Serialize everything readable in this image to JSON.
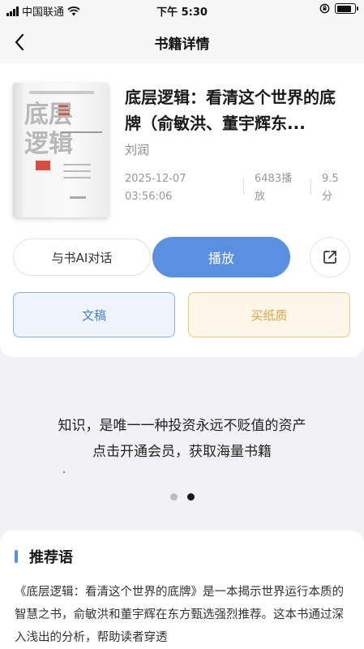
{
  "status_bar": {
    "carrier": "中国联通",
    "time": "下午 5:30",
    "battery_level": 0.85,
    "icons": [
      "signal-icon",
      "wifi-icon",
      "orientation-lock-icon",
      "battery-icon"
    ]
  },
  "nav": {
    "title": "书籍详情",
    "back_icon": "chevron-left-icon"
  },
  "book": {
    "title": "底层逻辑：看清这个世界的底牌（俞敏洪、董宇辉东...",
    "author": "刘润",
    "date": "2025-12-07",
    "time": "03:56:06",
    "plays": "6483播放",
    "score": "9.5分",
    "cover_title": "底层逻辑"
  },
  "actions": {
    "ai_chat_label": "与书AI对话",
    "play_label": "播放",
    "share_icon": "share-icon",
    "doc_label": "文稿",
    "paper_label": "买纸质"
  },
  "promo": {
    "line1": "知识，是唯一一种投资永远不贬值的资产",
    "line2": "点击开通会员，获取海量书籍",
    "page_count": 2,
    "active_page": 2
  },
  "recommend": {
    "heading": "推荐语",
    "text": "《底层逻辑：看清这个世界的底牌》是一本揭示世界运行本质的智慧之书，俞敏洪和董宇辉在东方甄选强烈推荐。这本书通过深入浅出的分析，帮助读者穿透"
  },
  "colors": {
    "accent": "#5b8fe0",
    "doc_border": "#8aaee0",
    "paper_accent": "#e2a43a"
  }
}
